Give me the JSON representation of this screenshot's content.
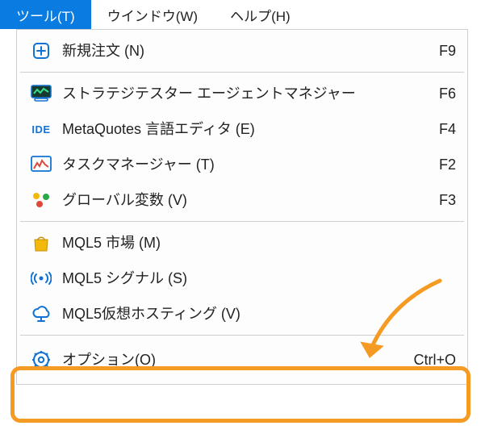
{
  "menubar": {
    "tools": {
      "label": "ツール(T)"
    },
    "window": {
      "label": "ウインドウ(W)"
    },
    "help": {
      "label": "ヘルプ(H)"
    }
  },
  "menu": {
    "new_order": {
      "label": "新規注文 (N)",
      "shortcut": "F9"
    },
    "strategy_tester": {
      "label": "ストラテジテスター エージェントマネジャー",
      "shortcut": "F6"
    },
    "metaeditor": {
      "label": "MetaQuotes 言語エディタ (E)",
      "shortcut": "F4",
      "icon_text": "IDE"
    },
    "task_manager": {
      "label": "タスクマネージャー (T)",
      "shortcut": "F2"
    },
    "global_vars": {
      "label": "グローバル変数 (V)",
      "shortcut": "F3"
    },
    "mql5_market": {
      "label": "MQL5 市場 (M)"
    },
    "mql5_signals": {
      "label": "MQL5 シグナル (S)"
    },
    "mql5_vps": {
      "label": "MQL5仮想ホスティング (V)"
    },
    "options": {
      "label": "オプション(O)",
      "shortcut": "Ctrl+O"
    }
  },
  "colors": {
    "accent": "#0a7be0",
    "icon": "#1172d3",
    "highlight": "#f59a22"
  }
}
